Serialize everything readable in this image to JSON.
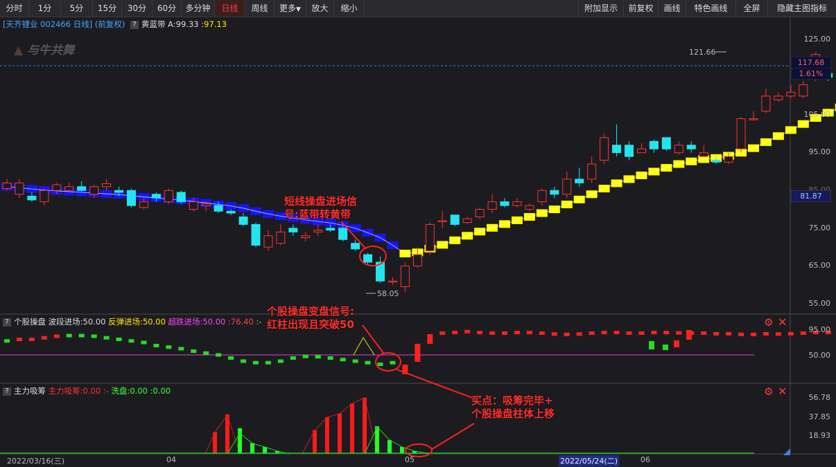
{
  "toolbar": {
    "left": [
      "分时",
      "1分",
      "5分",
      "15分",
      "30分",
      "60分",
      "多分钟",
      "日线",
      "周线",
      "更多",
      "放大",
      "缩小"
    ],
    "more_arrow": "▼",
    "right": [
      "附加显示",
      "前复权",
      "画线",
      "特色画线",
      "全屏",
      "隐藏主图指标"
    ]
  },
  "main": {
    "title": "[天齐锂业 002466 日线] (前复权)",
    "indicator_name": "黄蓝带",
    "val_a": "A:99.33",
    "val_b": ":97.13",
    "logo_text": "与牛共舞",
    "high_label": "121.66",
    "low_label": "58.05",
    "cur_price": "117.68",
    "cur_pct": "1.61%",
    "cross_price": "81.87",
    "y_ticks": [
      "125.00",
      "115.00",
      "105.00",
      "95.00",
      "85.00",
      "75.00",
      "65.00",
      "55.00"
    ]
  },
  "panel2": {
    "name": "个股操盘",
    "l1": "波段进场:50.00",
    "l2": "反弹进场:50.00",
    "l3": "超跌进场:50.00",
    "l4": ":76.40",
    "l5": ":-",
    "y_ticks": [
      "95.00",
      "50.00"
    ]
  },
  "panel3": {
    "name": "主力吸筹",
    "l1": "主力吸筹:0.00",
    "l2": ":-",
    "l3": "洗盘:0.00",
    "l4": ":0.00",
    "y_ticks": [
      "56.78",
      "37.85",
      "18.93"
    ]
  },
  "x_labels": [
    "2022/03/16(三)",
    "04",
    "05",
    "2022/05/24(二)",
    "06"
  ],
  "annotations": {
    "a1": [
      "短线操盘进场信",
      "号:蓝带转黄带"
    ],
    "a2": [
      "个股操盘变盘信号:",
      "红柱出现且突破50"
    ],
    "a3": [
      "买点：吸筹完毕+",
      "个股操盘柱体上移"
    ]
  },
  "colors": {
    "up": "#ff3333",
    "down": "#22e5f0",
    "blue_band": "#1515ff",
    "yellow_band": "#ffff00",
    "accent": "#ff3030"
  },
  "chart_data": {
    "type": "candlestick",
    "ylim": [
      55,
      125
    ],
    "candles": [
      [
        85.5,
        87,
        85,
        88
      ],
      [
        84,
        87,
        83,
        88
      ],
      [
        83.5,
        82.5,
        82,
        84.5
      ],
      [
        82,
        85,
        81,
        85.5
      ],
      [
        85,
        86.5,
        84,
        87
      ],
      [
        85,
        86,
        84.5,
        87
      ],
      [
        86,
        85,
        84.5,
        87.5
      ],
      [
        84,
        86,
        83,
        86.5
      ],
      [
        86,
        86.8,
        85,
        88
      ],
      [
        85,
        84.5,
        83.5,
        86
      ],
      [
        85,
        81,
        80.5,
        85.5
      ],
      [
        80.5,
        82,
        80,
        83
      ],
      [
        84,
        83,
        82,
        84.5
      ],
      [
        82,
        85,
        81.5,
        85.5
      ],
      [
        84.5,
        82,
        81.5,
        85
      ],
      [
        80,
        82,
        79.5,
        83
      ],
      [
        81,
        81.5,
        79.5,
        82
      ],
      [
        81,
        79.5,
        79,
        82
      ],
      [
        79.5,
        79,
        78.5,
        80
      ],
      [
        78,
        76,
        75.5,
        79
      ],
      [
        76,
        70.5,
        70,
        76.5
      ],
      [
        70,
        73,
        69,
        74.5
      ],
      [
        71,
        74,
        70.5,
        76
      ],
      [
        75,
        74,
        73,
        76
      ],
      [
        72.5,
        73,
        71.5,
        74
      ],
      [
        74,
        74.5,
        73,
        76
      ],
      [
        75,
        74.5,
        74,
        76
      ],
      [
        75,
        72,
        71.5,
        75.5
      ],
      [
        71,
        69.5,
        69,
        72
      ],
      [
        68,
        66,
        65.5,
        68.5
      ],
      [
        66,
        61,
        60.5,
        67.5
      ],
      [
        61,
        61,
        60,
        62
      ],
      [
        59.5,
        65,
        58.05,
        66
      ],
      [
        65,
        68,
        64.5,
        70
      ],
      [
        69,
        76,
        68,
        76.5
      ],
      [
        77,
        77,
        75,
        79.5
      ],
      [
        78.5,
        76,
        75.5,
        78.5
      ],
      [
        76.5,
        77.5,
        76,
        78
      ],
      [
        78,
        80,
        77.5,
        80.5
      ],
      [
        80,
        82,
        79,
        84
      ],
      [
        82,
        81,
        80.5,
        83
      ],
      [
        81,
        82,
        80.5,
        83
      ],
      [
        80,
        81,
        79.5,
        81.5
      ],
      [
        82,
        85,
        81,
        85.5
      ],
      [
        85,
        84,
        83,
        86
      ],
      [
        84,
        88,
        83,
        90
      ],
      [
        88,
        87,
        86,
        91
      ],
      [
        88,
        92,
        87,
        94
      ],
      [
        93,
        99,
        92,
        100
      ],
      [
        97,
        95,
        94,
        102.5
      ],
      [
        97,
        94,
        93,
        98
      ],
      [
        95,
        96,
        95,
        97.5
      ],
      [
        98,
        96,
        95,
        98.5
      ],
      [
        99,
        96,
        95.5,
        99
      ],
      [
        95,
        97,
        94.5,
        98
      ],
      [
        97,
        96,
        95,
        98
      ],
      [
        94,
        95,
        94,
        97
      ],
      [
        93,
        92.5,
        92,
        94
      ],
      [
        92.5,
        94,
        92,
        95
      ],
      [
        96,
        104,
        95,
        104.5
      ],
      [
        104,
        104,
        103.5,
        106
      ],
      [
        106,
        110,
        105.5,
        112
      ],
      [
        109,
        110,
        108.5,
        111
      ],
      [
        110,
        111,
        109.5,
        113
      ],
      [
        110,
        113,
        109.5,
        114
      ],
      [
        115,
        121,
        114,
        121.66
      ],
      [
        116,
        115,
        114,
        117
      ],
      [
        116,
        117.68,
        116,
        120
      ]
    ],
    "band": [
      86,
      85.7,
      85.4,
      85.1,
      84.9,
      84.7,
      84.5,
      84.3,
      84.1,
      83.9,
      83.6,
      83.3,
      83,
      82.7,
      82.4,
      82.1,
      81.7,
      81.3,
      80.9,
      80.3,
      79.5,
      78.8,
      78.2,
      77.7,
      77.2,
      76.8,
      76.4,
      75.8,
      75,
      73.8,
      72.5,
      70.5,
      68.3,
      68.6,
      69.6,
      70.6,
      71.8,
      73,
      74.1,
      75.1,
      76.1,
      77.1,
      78,
      79,
      80,
      81.3,
      82.6,
      84,
      85.5,
      86.9,
      88,
      89,
      90,
      91,
      92,
      92.7,
      93.3,
      93.6,
      94.2,
      95,
      96.2,
      97.8,
      99.4,
      101,
      102.6,
      104.2,
      105.6,
      107
    ],
    "band_color": [
      "b",
      "b",
      "b",
      "b",
      "b",
      "b",
      "b",
      "b",
      "b",
      "b",
      "b",
      "b",
      "b",
      "b",
      "b",
      "b",
      "b",
      "b",
      "b",
      "b",
      "b",
      "b",
      "b",
      "b",
      "b",
      "b",
      "b",
      "b",
      "b",
      "b",
      "b",
      "b",
      "y",
      "y",
      "y",
      "y",
      "y",
      "y",
      "y",
      "y",
      "y",
      "y",
      "y",
      "y",
      "y",
      "y",
      "y",
      "y",
      "y",
      "y",
      "y",
      "y",
      "y",
      "y",
      "y",
      "y",
      "y",
      "y",
      "y",
      "y",
      "y",
      "y",
      "y",
      "y",
      "y",
      "y",
      "y",
      "y"
    ],
    "osc": [
      0.45,
      0.5,
      0.5,
      0.55,
      0.6,
      0.62,
      0.62,
      0.6,
      0.55,
      0.5,
      0.45,
      0.4,
      0.3,
      0.25,
      0.2,
      0.12,
      0.06,
      0.0,
      -0.1,
      -0.2,
      -0.25,
      -0.25,
      -0.2,
      -0.1,
      -0.05,
      -0.06,
      -0.1,
      -0.15,
      -0.2,
      -0.25,
      -0.3,
      -0.25,
      -0.15,
      0.1,
      0.55,
      0.7,
      0.72,
      0.75,
      0.72,
      0.7,
      0.7,
      0.72,
      0.72,
      0.7,
      0.67,
      0.66,
      0.67,
      0.7,
      0.72,
      0.72,
      0.7,
      0.7,
      0.72,
      0.72,
      0.71,
      0.7,
      0.7,
      0.68,
      0.68,
      0.66,
      0.66,
      0.68,
      0.67,
      0.68,
      0.7,
      0.72,
      0.72,
      0.72
    ],
    "osc_red": [
      0,
      1,
      1,
      1,
      1,
      0,
      0,
      0,
      0,
      0,
      0,
      0,
      0,
      0,
      0,
      0,
      0,
      0,
      0,
      0,
      0,
      0,
      0,
      0,
      0,
      0,
      0,
      0,
      0,
      0,
      0,
      0,
      1,
      1,
      1,
      1,
      1,
      1,
      1,
      1,
      1,
      1,
      1,
      1,
      1,
      1,
      1,
      1,
      1,
      1,
      1,
      1,
      1,
      1,
      1,
      1,
      1,
      1,
      1,
      1,
      1,
      1,
      1,
      1,
      1,
      1,
      1,
      1
    ],
    "xishou": [
      0,
      0,
      0,
      0,
      0,
      0,
      0,
      0,
      0,
      0,
      0,
      0,
      0,
      0,
      0,
      0,
      0,
      0,
      22,
      33,
      0,
      0,
      0,
      0,
      0,
      0,
      0,
      0,
      0,
      0,
      0,
      0,
      0,
      0,
      0,
      0,
      0,
      0,
      0,
      0,
      0,
      0,
      0,
      0,
      0,
      0,
      0,
      0,
      0,
      0,
      0,
      0,
      0,
      0,
      0,
      0,
      0,
      0,
      0,
      0,
      0,
      0,
      0,
      0,
      0,
      0,
      0,
      0
    ],
    "xipan": [
      0,
      0,
      0,
      0,
      0,
      0,
      0,
      0,
      0,
      0,
      0,
      0,
      0,
      0,
      0,
      0,
      0,
      0,
      0,
      0,
      20,
      12,
      8,
      5,
      3,
      2,
      0,
      0,
      0,
      0,
      0,
      0,
      0,
      0,
      0,
      0,
      0,
      0,
      0,
      0,
      0,
      0,
      0,
      0,
      0,
      0,
      0,
      0,
      0,
      0,
      0,
      0,
      0,
      0,
      0,
      0,
      0,
      0,
      0,
      0,
      0,
      0,
      0,
      0,
      0,
      0,
      0,
      0
    ]
  }
}
